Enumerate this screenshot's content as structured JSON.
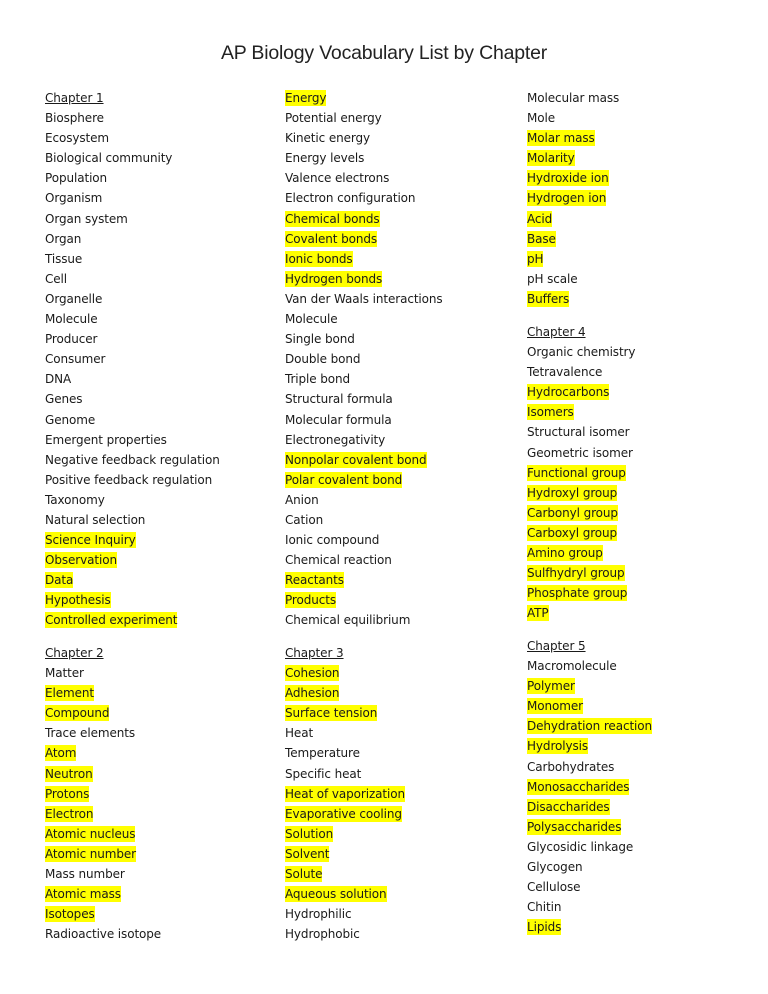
{
  "title": "AP Biology Vocabulary List by Chapter",
  "highlight_color": "#ffff00",
  "chapters": [
    {
      "heading": "Chapter 1",
      "terms": [
        {
          "text": "Biosphere",
          "highlighted": false
        },
        {
          "text": "Ecosystem",
          "highlighted": false
        },
        {
          "text": "Biological community",
          "highlighted": false
        },
        {
          "text": "Population",
          "highlighted": false
        },
        {
          "text": "Organism",
          "highlighted": false
        },
        {
          "text": "Organ system",
          "highlighted": false
        },
        {
          "text": "Organ",
          "highlighted": false
        },
        {
          "text": "Tissue",
          "highlighted": false
        },
        {
          "text": "Cell",
          "highlighted": false
        },
        {
          "text": "Organelle",
          "highlighted": false
        },
        {
          "text": "Molecule",
          "highlighted": false
        },
        {
          "text": "Producer",
          "highlighted": false
        },
        {
          "text": "Consumer",
          "highlighted": false
        },
        {
          "text": "DNA",
          "highlighted": false
        },
        {
          "text": "Genes",
          "highlighted": false
        },
        {
          "text": "Genome",
          "highlighted": false
        },
        {
          "text": "Emergent properties",
          "highlighted": false
        },
        {
          "text": "Negative feedback regulation",
          "highlighted": false
        },
        {
          "text": "Positive feedback regulation",
          "highlighted": false
        },
        {
          "text": "Taxonomy",
          "highlighted": false
        },
        {
          "text": "Natural selection",
          "highlighted": false
        },
        {
          "text": "Science Inquiry",
          "highlighted": true
        },
        {
          "text": "Observation",
          "highlighted": true
        },
        {
          "text": "Data",
          "highlighted": true
        },
        {
          "text": "Hypothesis",
          "highlighted": true
        },
        {
          "text": "Controlled experiment",
          "highlighted": true
        }
      ]
    },
    {
      "heading": "Chapter 2",
      "terms": [
        {
          "text": "Matter",
          "highlighted": false
        },
        {
          "text": "Element",
          "highlighted": true
        },
        {
          "text": "Compound",
          "highlighted": true
        },
        {
          "text": "Trace elements",
          "highlighted": false
        },
        {
          "text": "Atom",
          "highlighted": true
        },
        {
          "text": "Neutron",
          "highlighted": true
        },
        {
          "text": "Protons",
          "highlighted": true
        },
        {
          "text": "Electron",
          "highlighted": true
        },
        {
          "text": "Atomic nucleus",
          "highlighted": true
        },
        {
          "text": "Atomic number",
          "highlighted": true
        },
        {
          "text": "Mass number",
          "highlighted": false
        },
        {
          "text": "Atomic mass",
          "highlighted": true
        },
        {
          "text": "Isotopes",
          "highlighted": true
        },
        {
          "text": "Radioactive isotope",
          "highlighted": false
        },
        {
          "text": "Energy",
          "highlighted": true
        },
        {
          "text": "Potential energy",
          "highlighted": false
        },
        {
          "text": "Kinetic energy",
          "highlighted": false
        },
        {
          "text": "Energy levels",
          "highlighted": false
        },
        {
          "text": "Valence electrons",
          "highlighted": false
        },
        {
          "text": "Electron configuration",
          "highlighted": false
        },
        {
          "text": "Chemical bonds",
          "highlighted": true
        },
        {
          "text": "Covalent bonds",
          "highlighted": true
        },
        {
          "text": "Ionic bonds",
          "highlighted": true
        },
        {
          "text": "Hydrogen bonds",
          "highlighted": true
        },
        {
          "text": "Van der Waals interactions",
          "highlighted": false
        },
        {
          "text": "Molecule",
          "highlighted": false
        },
        {
          "text": "Single bond",
          "highlighted": false
        },
        {
          "text": "Double bond",
          "highlighted": false
        },
        {
          "text": "Triple bond",
          "highlighted": false
        },
        {
          "text": "Structural formula",
          "highlighted": false
        },
        {
          "text": "Molecular formula",
          "highlighted": false
        },
        {
          "text": "Electronegativity",
          "highlighted": false
        },
        {
          "text": "Nonpolar covalent bond",
          "highlighted": true
        },
        {
          "text": "Polar covalent bond",
          "highlighted": true
        },
        {
          "text": "Anion",
          "highlighted": false
        },
        {
          "text": "Cation",
          "highlighted": false
        },
        {
          "text": "Ionic compound",
          "highlighted": false
        },
        {
          "text": "Chemical reaction",
          "highlighted": false
        },
        {
          "text": "Reactants",
          "highlighted": true
        },
        {
          "text": "Products",
          "highlighted": true
        },
        {
          "text": "Chemical equilibrium",
          "highlighted": false
        }
      ]
    },
    {
      "heading": "Chapter 3",
      "terms": [
        {
          "text": "Cohesion",
          "highlighted": true
        },
        {
          "text": "Adhesion",
          "highlighted": true
        },
        {
          "text": "Surface tension",
          "highlighted": true
        },
        {
          "text": "Heat",
          "highlighted": false
        },
        {
          "text": "Temperature",
          "highlighted": false
        },
        {
          "text": "Specific heat",
          "highlighted": false
        },
        {
          "text": "Heat of vaporization",
          "highlighted": true
        },
        {
          "text": "Evaporative cooling",
          "highlighted": true
        },
        {
          "text": "Solution",
          "highlighted": true
        },
        {
          "text": "Solvent",
          "highlighted": true
        },
        {
          "text": "Solute",
          "highlighted": true
        },
        {
          "text": "Aqueous solution",
          "highlighted": true
        },
        {
          "text": "Hydrophilic",
          "highlighted": false
        },
        {
          "text": "Hydrophobic",
          "highlighted": false
        },
        {
          "text": "Molecular mass",
          "highlighted": false
        },
        {
          "text": "Mole",
          "highlighted": false
        },
        {
          "text": "Molar mass",
          "highlighted": true
        },
        {
          "text": "Molarity",
          "highlighted": true
        },
        {
          "text": "Hydroxide ion",
          "highlighted": true
        },
        {
          "text": "Hydrogen ion",
          "highlighted": true
        },
        {
          "text": "Acid",
          "highlighted": true
        },
        {
          "text": "Base",
          "highlighted": true
        },
        {
          "text": "pH",
          "highlighted": true
        },
        {
          "text": "pH scale",
          "highlighted": false
        },
        {
          "text": "Buffers",
          "highlighted": true
        }
      ]
    },
    {
      "heading": "Chapter 4",
      "terms": [
        {
          "text": "Organic chemistry",
          "highlighted": false
        },
        {
          "text": "Tetravalence",
          "highlighted": false
        },
        {
          "text": "Hydrocarbons",
          "highlighted": true
        },
        {
          "text": "Isomers",
          "highlighted": true
        },
        {
          "text": "Structural isomer",
          "highlighted": false
        },
        {
          "text": "Geometric isomer",
          "highlighted": false
        },
        {
          "text": "Functional group",
          "highlighted": true
        },
        {
          "text": "Hydroxyl group",
          "highlighted": true
        },
        {
          "text": "Carbonyl group",
          "highlighted": true
        },
        {
          "text": "Carboxyl group",
          "highlighted": true
        },
        {
          "text": "Amino group",
          "highlighted": true
        },
        {
          "text": "Sulfhydryl group",
          "highlighted": true
        },
        {
          "text": "Phosphate group",
          "highlighted": true
        },
        {
          "text": "ATP",
          "highlighted": true
        }
      ]
    },
    {
      "heading": "Chapter 5",
      "terms": [
        {
          "text": "Macromolecule",
          "highlighted": false
        },
        {
          "text": "Polymer",
          "highlighted": true
        },
        {
          "text": "Monomer",
          "highlighted": true
        },
        {
          "text": "Dehydration reaction",
          "highlighted": true
        },
        {
          "text": "Hydrolysis",
          "highlighted": true
        },
        {
          "text": "Carbohydrates",
          "highlighted": false
        },
        {
          "text": "Monosaccharides",
          "highlighted": true
        },
        {
          "text": "Disaccharides",
          "highlighted": true
        },
        {
          "text": "Polysaccharides",
          "highlighted": true
        },
        {
          "text": "Glycosidic linkage",
          "highlighted": false
        },
        {
          "text": "Glycogen",
          "highlighted": false
        },
        {
          "text": "Cellulose",
          "highlighted": false
        },
        {
          "text": "Chitin",
          "highlighted": false
        },
        {
          "text": "Lipids",
          "highlighted": true
        }
      ]
    }
  ]
}
